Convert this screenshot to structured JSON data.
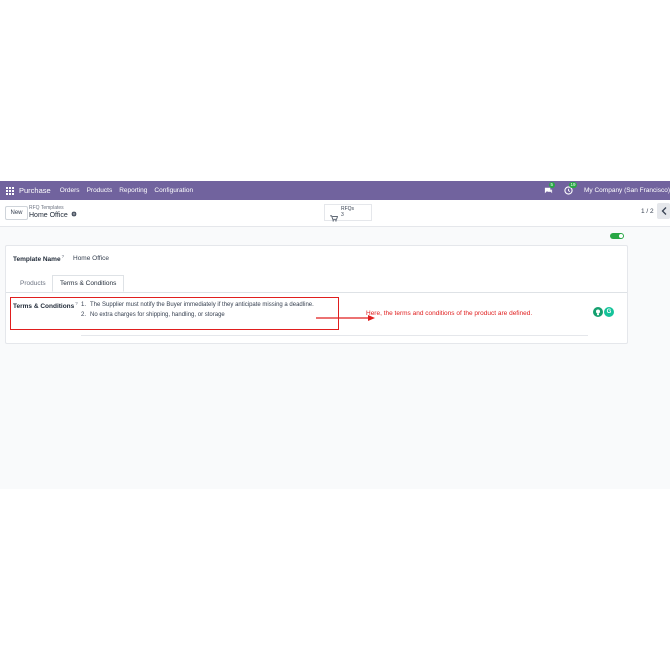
{
  "navbar": {
    "app_name": "Purchase",
    "menus": [
      "Orders",
      "Products",
      "Reporting",
      "Configuration"
    ],
    "messages_count": "5",
    "activities_count": "19",
    "company": "My Company (San Francisco)"
  },
  "control": {
    "new_label": "New",
    "breadcrumb": "RFQ Templates",
    "record_title": "Home Office",
    "smart_button": {
      "label": "RFQs",
      "count": "3"
    },
    "pager": "1 / 2"
  },
  "form": {
    "template_name_label": "Template Name",
    "template_name_help": "?",
    "template_name_value": "Home Office",
    "tabs": [
      "Products",
      "Terms & Conditions"
    ],
    "terms_label": "Terms & Conditions",
    "terms_help": "?",
    "terms": [
      {
        "num": "1.",
        "text": "The Supplier must notify the Buyer immediately if they anticipate missing a deadline."
      },
      {
        "num": "2.",
        "text": "No extra charges for shipping, handling, or storage"
      }
    ]
  },
  "annotation": "Here, the terms and conditions of the product are defined.",
  "colors": {
    "navbar": "#71639e",
    "annotation": "#e01e1e",
    "toggle": "#28a745"
  }
}
